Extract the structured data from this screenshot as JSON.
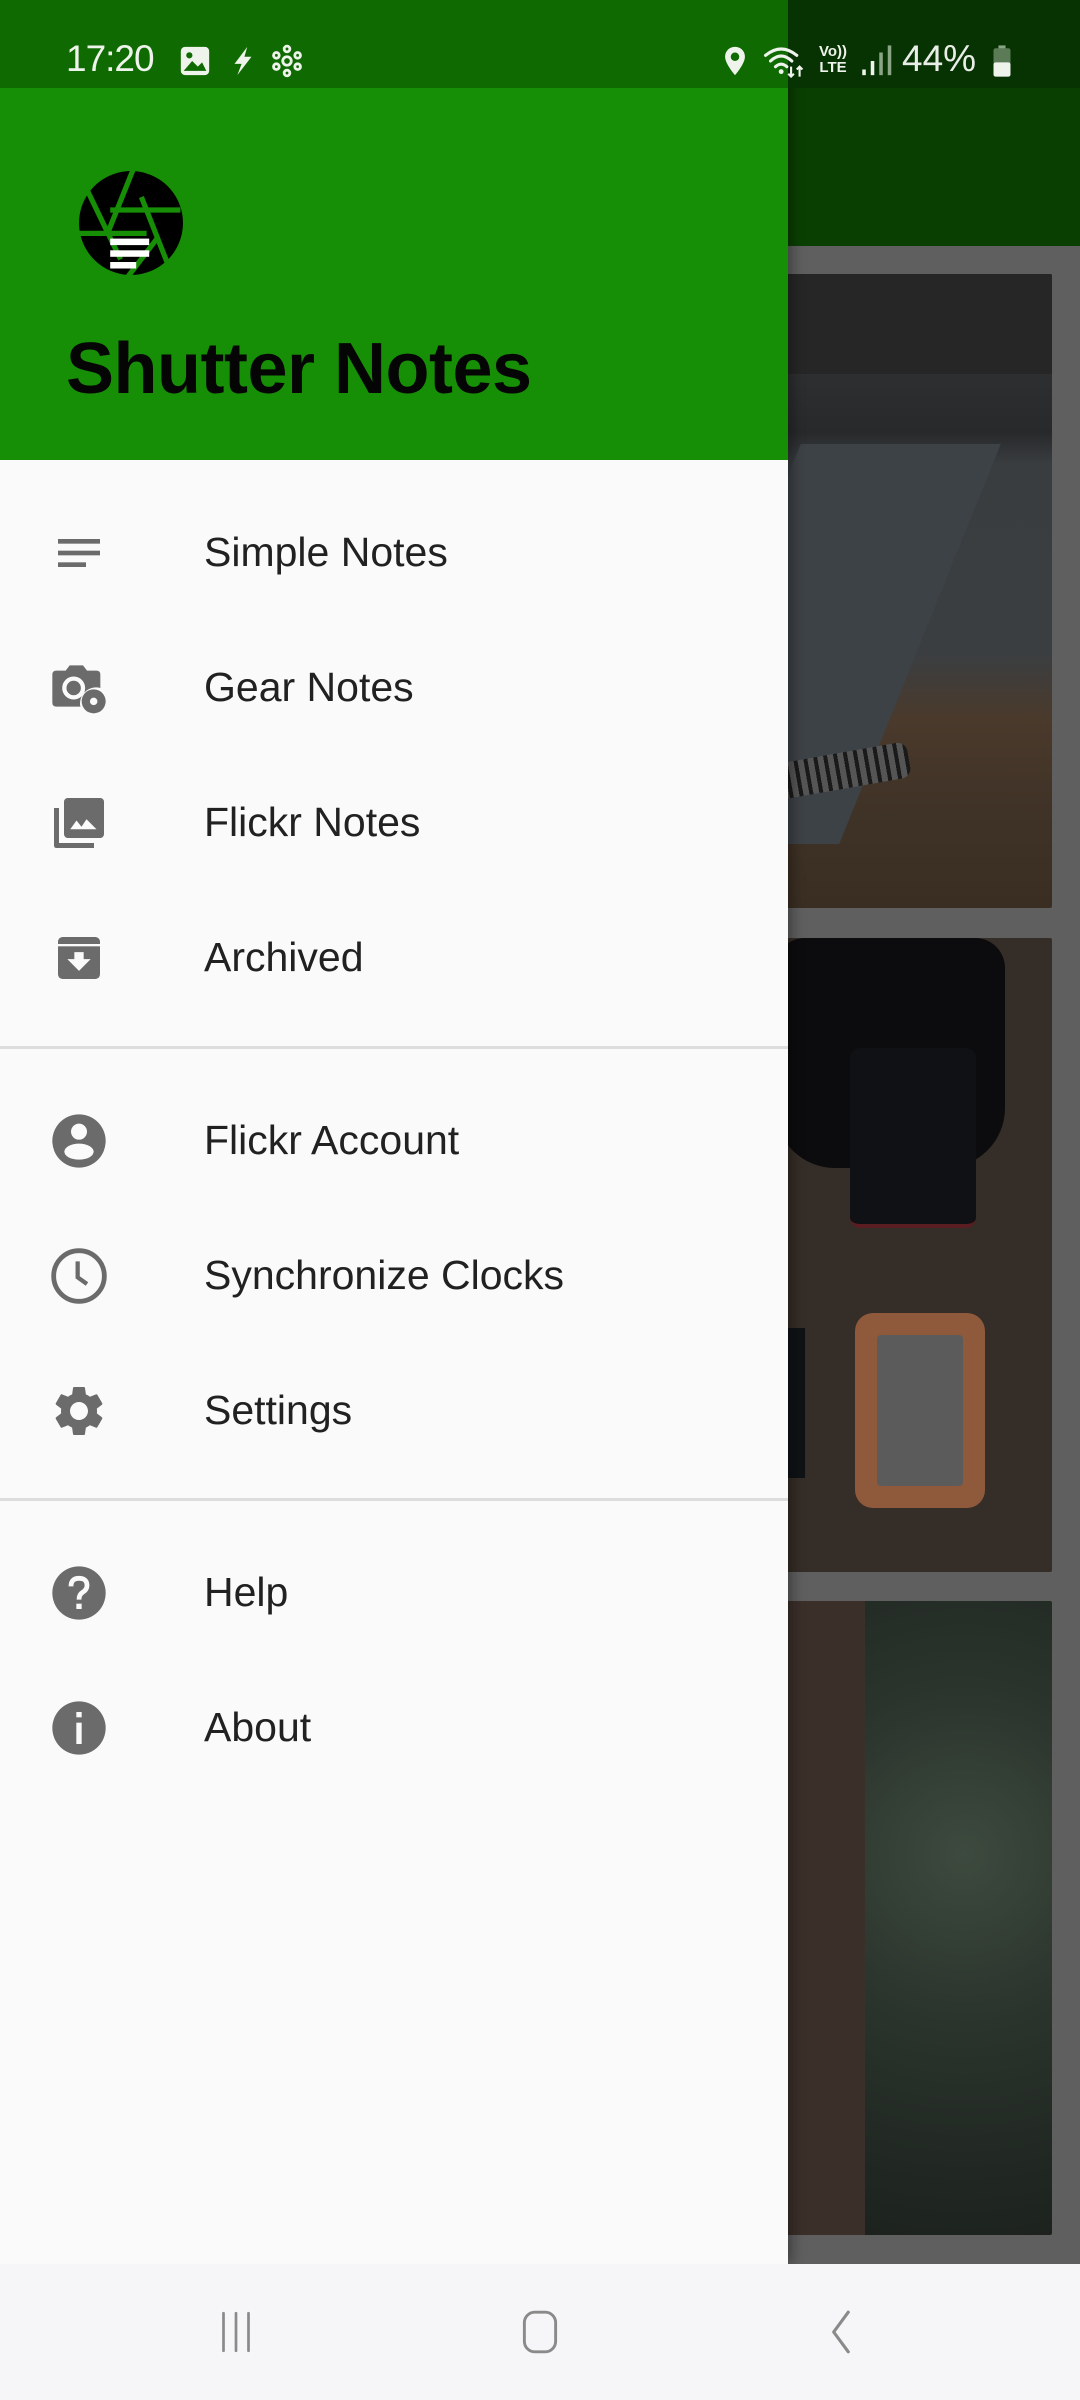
{
  "status_bar": {
    "time": "17:20",
    "left_icons": [
      "gallery-notification-icon",
      "flash-icon",
      "hotspot-hub-icon"
    ],
    "right_icons": [
      "location-icon",
      "wifi-icon",
      "volte-icon",
      "signal-icon",
      "battery-icon"
    ],
    "volte_top": "Vo))",
    "volte_bottom": "LTE",
    "battery_percent": "44%",
    "battery_level": 0.44
  },
  "drawer": {
    "app_title": "Shutter Notes",
    "logo_icon": "shutter-notes-logo-icon",
    "header_color": "#168e05",
    "groups": [
      {
        "items": [
          {
            "label": "Simple Notes",
            "icon": "notes-lines-icon"
          },
          {
            "label": "Gear Notes",
            "icon": "camera-gear-icon"
          },
          {
            "label": "Flickr Notes",
            "icon": "photo-library-icon"
          },
          {
            "label": "Archived",
            "icon": "archive-icon"
          }
        ]
      },
      {
        "items": [
          {
            "label": "Flickr Account",
            "icon": "account-circle-icon"
          },
          {
            "label": "Synchronize Clocks",
            "icon": "clock-icon"
          },
          {
            "label": "Settings",
            "icon": "settings-gear-icon"
          }
        ]
      },
      {
        "items": [
          {
            "label": "Help",
            "icon": "help-icon"
          },
          {
            "label": "About",
            "icon": "info-icon"
          }
        ]
      }
    ]
  },
  "background": {
    "cards": [
      "notebook-photo",
      "camera-gear-photo",
      "tree-trunk-photo"
    ]
  },
  "nav_bar": {
    "recents": "recent-apps-icon",
    "home": "home-icon",
    "back": "back-icon"
  }
}
